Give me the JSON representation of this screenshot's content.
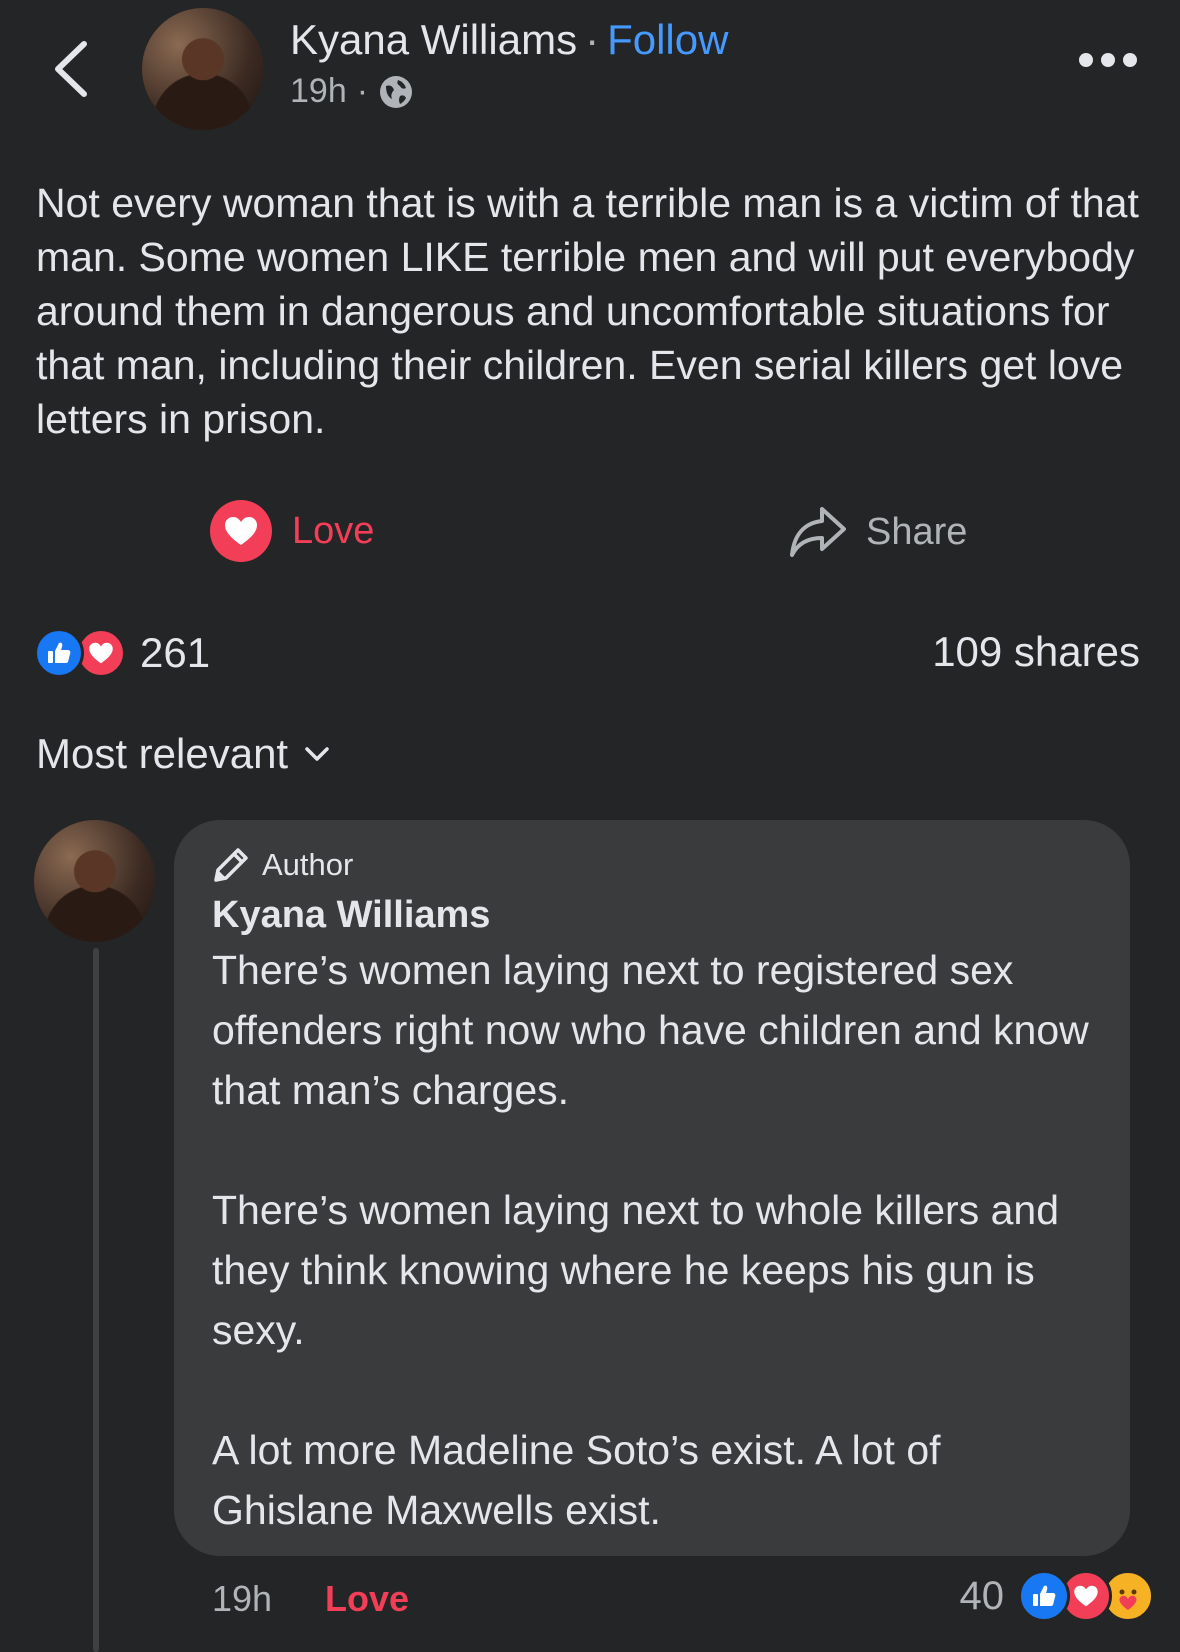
{
  "header": {
    "author_name": "Kyana Williams",
    "separator": "·",
    "follow_label": "Follow",
    "time": "19h",
    "meta_separator": "·"
  },
  "post": {
    "text": "Not every woman that is with a terrible man is a victim of that man. Some women LIKE terrible men and will put everybody around them in dangerous and uncomfortable situations for that man, including their children. Even serial killers get love letters in prison."
  },
  "actions": {
    "love_label": "Love",
    "share_label": "Share"
  },
  "stats": {
    "reaction_count": "261",
    "shares_label": "109 shares"
  },
  "comments_sort": {
    "label": "Most relevant"
  },
  "comment": {
    "author_badge": "Author",
    "name": "Kyana Williams",
    "paragraphs": [
      "There’s women laying next to registered sex offenders right now who have children and know that man’s charges.",
      "There’s women laying next to whole killers and they think knowing where he keeps his gun is sexy.",
      "A lot more Madeline Soto’s exist. A lot of Ghislane Maxwells exist."
    ],
    "time": "19h",
    "love_label": "Love",
    "reaction_count": "40"
  },
  "colors": {
    "background": "#242526",
    "bubble": "#3a3b3c",
    "link_blue": "#4599ff",
    "love_red": "#f33e58",
    "like_blue": "#1877f2"
  },
  "icons": [
    "back-chevron-icon",
    "globe-icon",
    "more-dots-icon",
    "heart-icon",
    "share-arrow-icon",
    "like-thumb-icon",
    "chevron-down-icon",
    "pen-icon",
    "care-emoji-icon"
  ]
}
